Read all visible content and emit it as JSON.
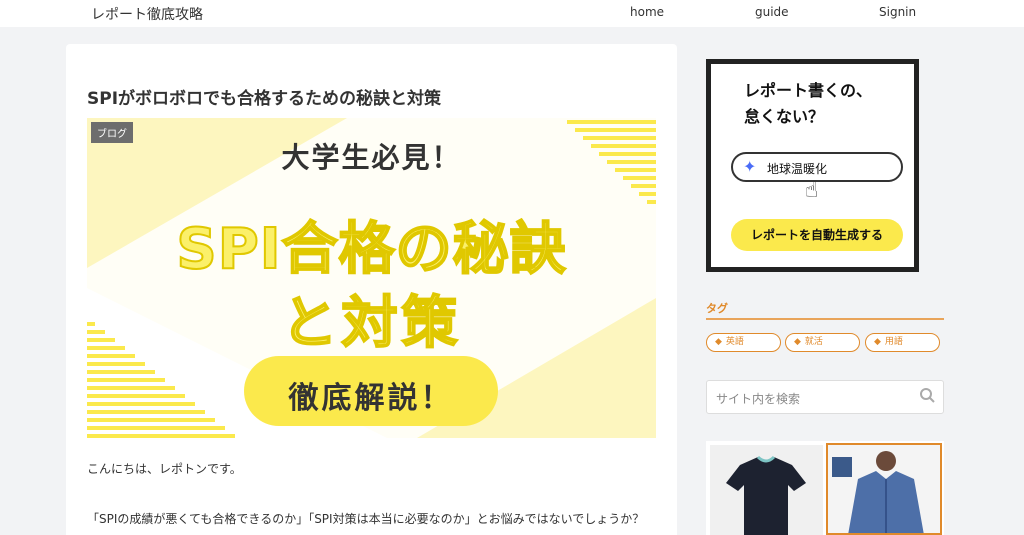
{
  "header": {
    "site_title": "レポート徹底攻略",
    "nav": {
      "home": "home",
      "guide": "guide",
      "signin": "Signin"
    }
  },
  "article": {
    "title": "SPIがボロボロでも合格するための秘訣と対策",
    "category": "ブログ",
    "eyecatch": {
      "subtitle": "大学生必見！",
      "main_line1": "SPI合格の秘訣",
      "main_line2": "と対策",
      "pill": "徹底解説！"
    },
    "paragraphs": [
      "こんにちは、レポトンです。",
      "「SPIの成績が悪くても合格できるのか」「SPI対策は本当に必要なのか」とお悩みではないでしょうか？"
    ]
  },
  "sidebar": {
    "ad": {
      "headline_1": "レポート書くの、",
      "headline_2": "怠くない？",
      "input_text": "地球温暖化",
      "button": "レポートを自動生成する"
    },
    "tags_title": "タグ",
    "tags": [
      "英語",
      "就活",
      "用語"
    ],
    "search_placeholder": "サイト内を検索"
  },
  "colors": {
    "accent_orange": "#e08a2b",
    "yellow": "#fbe94c",
    "page_bg": "#f2f3f5"
  }
}
